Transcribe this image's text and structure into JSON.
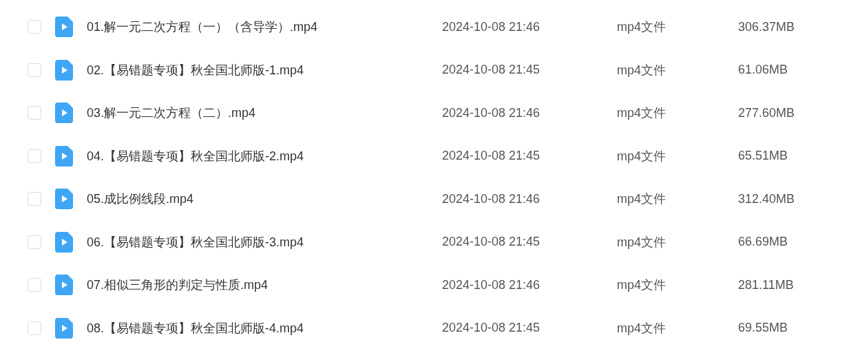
{
  "files": [
    {
      "name": "01.解一元二次方程（一）（含导学）.mp4",
      "modified": "2024-10-08 21:46",
      "type": "mp4文件",
      "size": "306.37MB",
      "checked": false
    },
    {
      "name": "02.【易错题专项】秋全国北师版-1.mp4",
      "modified": "2024-10-08 21:45",
      "type": "mp4文件",
      "size": "61.06MB",
      "checked": false
    },
    {
      "name": "03.解一元二次方程（二）.mp4",
      "modified": "2024-10-08 21:46",
      "type": "mp4文件",
      "size": "277.60MB",
      "checked": false
    },
    {
      "name": "04.【易错题专项】秋全国北师版-2.mp4",
      "modified": "2024-10-08 21:45",
      "type": "mp4文件",
      "size": "65.51MB",
      "checked": false
    },
    {
      "name": "05.成比例线段.mp4",
      "modified": "2024-10-08 21:46",
      "type": "mp4文件",
      "size": "312.40MB",
      "checked": false
    },
    {
      "name": "06.【易错题专项】秋全国北师版-3.mp4",
      "modified": "2024-10-08 21:45",
      "type": "mp4文件",
      "size": "66.69MB",
      "checked": false
    },
    {
      "name": "07.相似三角形的判定与性质.mp4",
      "modified": "2024-10-08 21:46",
      "type": "mp4文件",
      "size": "281.11MB",
      "checked": false
    },
    {
      "name": "08.【易错题专项】秋全国北师版-4.mp4",
      "modified": "2024-10-08 21:45",
      "type": "mp4文件",
      "size": "69.55MB",
      "checked": false
    }
  ]
}
